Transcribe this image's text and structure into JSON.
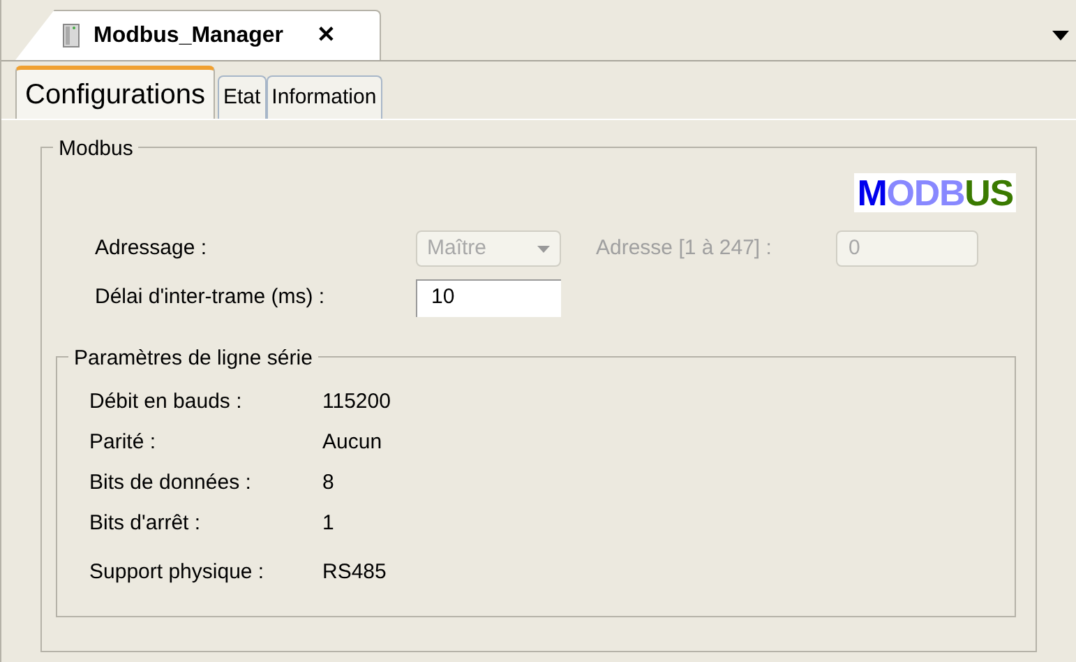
{
  "document_tab": {
    "title": "Modbus_Manager",
    "close": "✕"
  },
  "tabs": [
    {
      "label": "Configurations",
      "selected": true
    },
    {
      "label": "Etat",
      "selected": false
    },
    {
      "label": "Information",
      "selected": false
    }
  ],
  "modbus_group": {
    "title": "Modbus",
    "logo": "MODBUS",
    "addressing": {
      "label": "Adressage :",
      "value": "Maître",
      "disabled": true
    },
    "address": {
      "label": "Adresse [1 à 247] :",
      "value": "0",
      "disabled": true
    },
    "interframe_delay": {
      "label": "Délai d'inter-trame (ms) :",
      "value": "10"
    }
  },
  "serial_group": {
    "title": "Paramètres de ligne série",
    "rows": [
      {
        "label": "Débit en bauds :",
        "value": "115200"
      },
      {
        "label": "Parité :",
        "value": "Aucun"
      },
      {
        "label": "Bits de données :",
        "value": "8"
      },
      {
        "label": "Bits d'arrêt :",
        "value": "1"
      },
      {
        "label": "Support physique :",
        "value": "RS485"
      }
    ]
  }
}
